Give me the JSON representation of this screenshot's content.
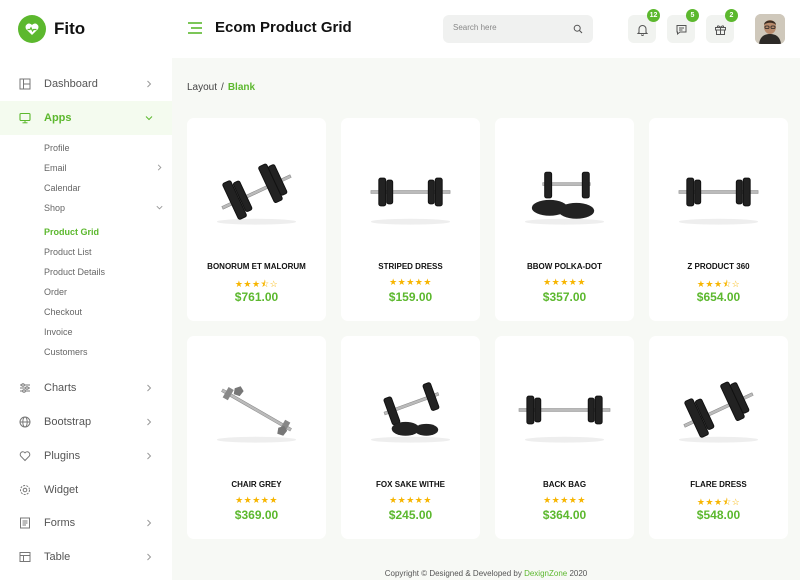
{
  "brand": {
    "name": "Fito"
  },
  "header": {
    "title": "Ecom Product Grid",
    "search_placeholder": "Search here",
    "notifications_count": "12",
    "messages_count": "5",
    "gifts_count": "2"
  },
  "sidebar": {
    "menu": [
      {
        "label": "Dashboard",
        "icon": "dashboard-icon"
      },
      {
        "label": "Apps",
        "icon": "monitor-icon"
      },
      {
        "label": "Charts",
        "icon": "sliders-icon"
      },
      {
        "label": "Bootstrap",
        "icon": "globe-icon"
      },
      {
        "label": "Plugins",
        "icon": "heart-icon"
      },
      {
        "label": "Widget",
        "icon": "gear-icon"
      },
      {
        "label": "Forms",
        "icon": "form-icon"
      },
      {
        "label": "Table",
        "icon": "table-icon"
      }
    ],
    "apps_sub": [
      "Profile",
      "Email",
      "Calendar",
      "Shop",
      "Product Grid",
      "Product List",
      "Product Details",
      "Order",
      "Checkout",
      "Invoice",
      "Customers"
    ]
  },
  "breadcrumb": {
    "parent": "Layout",
    "separator": "/",
    "current": "Blank"
  },
  "products": [
    {
      "name": "BONORUM ET MALORUM",
      "rating": 3.5,
      "price": "$761.00"
    },
    {
      "name": "STRIPED DRESS",
      "rating": 5,
      "price": "$159.00"
    },
    {
      "name": "BBOW POLKA-DOT",
      "rating": 5,
      "price": "$357.00"
    },
    {
      "name": "Z PRODUCT 360",
      "rating": 3.5,
      "price": "$654.00"
    },
    {
      "name": "CHAIR GREY",
      "rating": 5,
      "price": "$369.00"
    },
    {
      "name": "FOX SAKE WITHE",
      "rating": 5,
      "price": "$245.00"
    },
    {
      "name": "BACK BAG",
      "rating": 5,
      "price": "$364.00"
    },
    {
      "name": "FLARE DRESS",
      "rating": 3.5,
      "price": "$548.00"
    }
  ],
  "footer": {
    "prefix": "Copyright © Designed & Developed by",
    "company": "DexignZone",
    "year": "2020"
  },
  "colors": {
    "accent": "#5cb82e",
    "star": "#f7b500",
    "background": "#f7f9f5"
  }
}
